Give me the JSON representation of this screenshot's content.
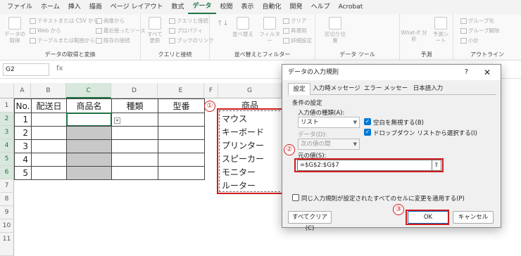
{
  "ribbon": {
    "tabs": [
      "ファイル",
      "ホーム",
      "挿入",
      "描画",
      "ページ レイアウト",
      "数式",
      "データ",
      "校閲",
      "表示",
      "自動化",
      "開発",
      "ヘルプ",
      "Acrobat"
    ],
    "active_tab": "データ",
    "groups": {
      "get_data": {
        "caption": "データの取得と変換",
        "big_button": "データの取得",
        "items": [
          "テキストまたは CSV から",
          "Web から",
          "テーブルまたは範囲から",
          "画像から",
          "最近使ったソース",
          "既存の接続"
        ]
      },
      "queries": {
        "caption": "クエリと接続",
        "big_button": "すべて更新",
        "items": [
          "クエリと接続",
          "プロパティ",
          "ブックのリンク"
        ]
      },
      "sort_filter": {
        "caption": "並べ替えとフィルター",
        "sort_button": "並べ替え",
        "filter_button": "フィルター",
        "items": [
          "クリア",
          "再適用",
          "詳細設定"
        ]
      },
      "data_tools": {
        "caption": "データ ツール",
        "big_button": "区切り位置"
      },
      "forecast": {
        "caption": "予測",
        "whatif": "What-If 分析",
        "sheet": "予測シート"
      },
      "outline": {
        "caption": "アウトライン",
        "items": [
          "グループ化",
          "グループ解除",
          "小計"
        ]
      }
    }
  },
  "formula_bar": {
    "name_box": "G2",
    "fx": "fx"
  },
  "sheet": {
    "columns": [
      "A",
      "B",
      "C",
      "D",
      "E",
      "F",
      "G"
    ],
    "rows": [
      "1",
      "2",
      "3",
      "4",
      "5",
      "6",
      "7",
      "8",
      "9",
      "10",
      "11"
    ],
    "headers": [
      "No.",
      "配送日",
      "商品名",
      "種類",
      "型番"
    ],
    "numbers": [
      "1",
      "2",
      "3",
      "4",
      "5"
    ],
    "product_header": "商品",
    "products": [
      "マウス",
      "キーボード",
      "プリンター",
      "スピーカー",
      "モニター",
      "ルーター"
    ]
  },
  "annotations": [
    "①",
    "②",
    "③"
  ],
  "dialog": {
    "title": "データの入力規則",
    "help": "?",
    "close": "✕",
    "tabs": [
      "設定",
      "入力時メッセージ",
      "エラー メッセージ",
      "日本語入力"
    ],
    "section": "条件の設定",
    "allow_label": "入力値の種類(A):",
    "allow_value": "リスト",
    "ignore_blank": "空白を無視する(B)",
    "dropdown": "ドロップダウン リストから選択する(I)",
    "data_label": "データ(D):",
    "data_value": "次の値の間",
    "source_label": "元の値(S):",
    "source_value": "=$G$2:$G$7",
    "apply_all": "同じ入力規則が設定されたすべてのセルに変更を適用する(P)",
    "clear_all": "すべてクリア(C)",
    "ok": "OK",
    "cancel": "キャンセル"
  },
  "colors": {
    "accent": "#217346",
    "annotation": "#d01c1c",
    "checkbox": "#0078d4"
  }
}
